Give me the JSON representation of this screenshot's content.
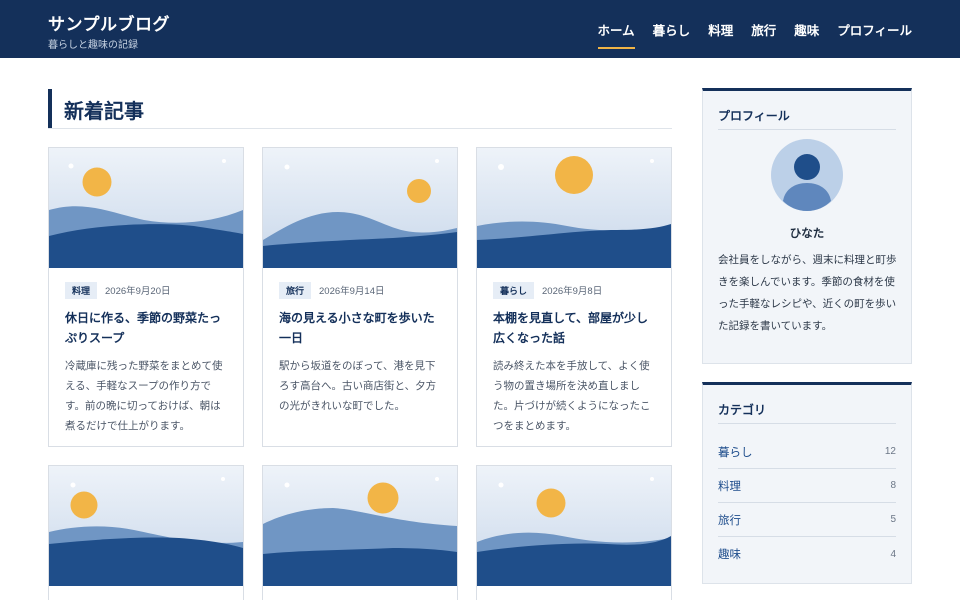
{
  "site": {
    "title": "サンプルブログ",
    "tagline": "暮らしと趣味の記録"
  },
  "nav": [
    {
      "label": "ホーム",
      "active": true
    },
    {
      "label": "暮らし",
      "active": false
    },
    {
      "label": "料理",
      "active": false
    },
    {
      "label": "旅行",
      "active": false
    },
    {
      "label": "趣味",
      "active": false
    },
    {
      "label": "プロフィール",
      "active": false
    }
  ],
  "main": {
    "section_title": "新着記事",
    "posts": [
      {
        "tag": "料理",
        "date": "2026年9月20日",
        "title": "休日に作る、季節の野菜たっぷりスープ",
        "excerpt": "冷蔵庫に残った野菜をまとめて使える、手軽なスープの作り方です。前の晩に切っておけば、朝は煮るだけで仕上がります。"
      },
      {
        "tag": "旅行",
        "date": "2026年9月14日",
        "title": "海の見える小さな町を歩いた一日",
        "excerpt": "駅から坂道をのぼって、港を見下ろす高台へ。古い商店街と、夕方の光がきれいな町でした。"
      },
      {
        "tag": "暮らし",
        "date": "2026年9月8日",
        "title": "本棚を見直して、部屋が少し広くなった話",
        "excerpt": "読み終えた本を手放して、よく使う物の置き場所を決め直しました。片づけが続くようになったこつをまとめます。"
      },
      {
        "tag": "",
        "date": "",
        "title": "",
        "excerpt": ""
      },
      {
        "tag": "",
        "date": "",
        "title": "",
        "excerpt": ""
      },
      {
        "tag": "",
        "date": "",
        "title": "",
        "excerpt": ""
      }
    ]
  },
  "sidebar": {
    "profile": {
      "heading": "プロフィール",
      "name": "ひなた",
      "bio": "会社員をしながら、週末に料理と町歩きを楽しんでいます。季節の食材を使った手軽なレシピや、近くの町を歩いた記録を書いています。"
    },
    "categories": {
      "heading": "カテゴリ",
      "items": [
        {
          "label": "暮らし",
          "count": "12"
        },
        {
          "label": "料理",
          "count": "8"
        },
        {
          "label": "旅行",
          "count": "5"
        },
        {
          "label": "趣味",
          "count": "4"
        }
      ]
    }
  },
  "colors": {
    "header_bg": "#14305a",
    "accent": "#f0b446",
    "link": "#1e4d8c",
    "sky_top": "#cfdcec",
    "hill_light": "#7096c4",
    "hill_dark": "#1f4e8a"
  }
}
